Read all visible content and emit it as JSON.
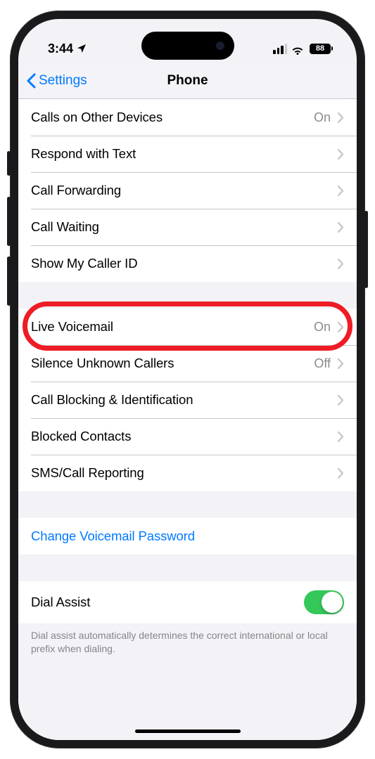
{
  "status_bar": {
    "time": "3:44",
    "battery_percent": "88"
  },
  "nav": {
    "back_label": "Settings",
    "title": "Phone"
  },
  "group1": [
    {
      "label": "Calls on Other Devices",
      "value": "On"
    },
    {
      "label": "Respond with Text"
    },
    {
      "label": "Call Forwarding"
    },
    {
      "label": "Call Waiting"
    },
    {
      "label": "Show My Caller ID"
    }
  ],
  "group2": [
    {
      "label": "Live Voicemail",
      "value": "On",
      "highlighted": true
    },
    {
      "label": "Silence Unknown Callers",
      "value": "Off"
    },
    {
      "label": "Call Blocking & Identification"
    },
    {
      "label": "Blocked Contacts"
    },
    {
      "label": "SMS/Call Reporting"
    }
  ],
  "group3": [
    {
      "label": "Change Voicemail Password",
      "link": true
    }
  ],
  "group4": {
    "label": "Dial Assist",
    "toggle_on": true,
    "footer": "Dial assist automatically determines the correct international or local prefix when dialing."
  }
}
